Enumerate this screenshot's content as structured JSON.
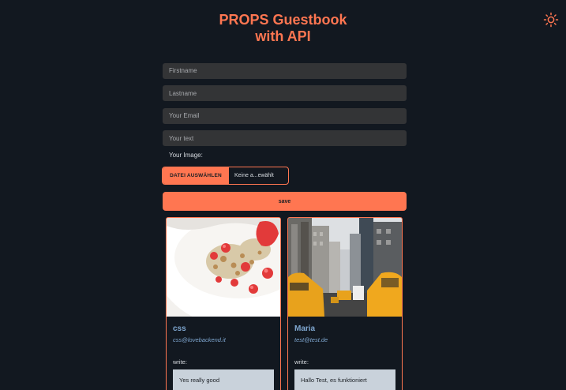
{
  "header": {
    "title_line1": "PROPS Guestbook",
    "title_line2": "with API",
    "theme_icon": "sun-icon"
  },
  "form": {
    "firstname_placeholder": "Firstname",
    "lastname_placeholder": "Lastname",
    "email_placeholder": "Your Email",
    "text_placeholder": "Your text",
    "image_label": "Your Image:",
    "file_button_label": "DATEI AUSWÄHLEN",
    "file_status": "Keine a...ewählt",
    "save_label": "save"
  },
  "entries": [
    {
      "name": "css",
      "email": "css@lovebackend.it",
      "write_label": "write:",
      "text": "Yes really good",
      "image": "yogurt-strawberry-photo"
    },
    {
      "name": "Maria",
      "email": "test@test.de",
      "write_label": "write:",
      "text": "Hallo Test, es funktioniert",
      "image": "city-taxi-photo"
    }
  ],
  "colors": {
    "background": "#121820",
    "accent": "#ff7651",
    "input_bg": "#333436",
    "link_blue": "#7fa7d0",
    "message_bg": "#c9d2db"
  }
}
